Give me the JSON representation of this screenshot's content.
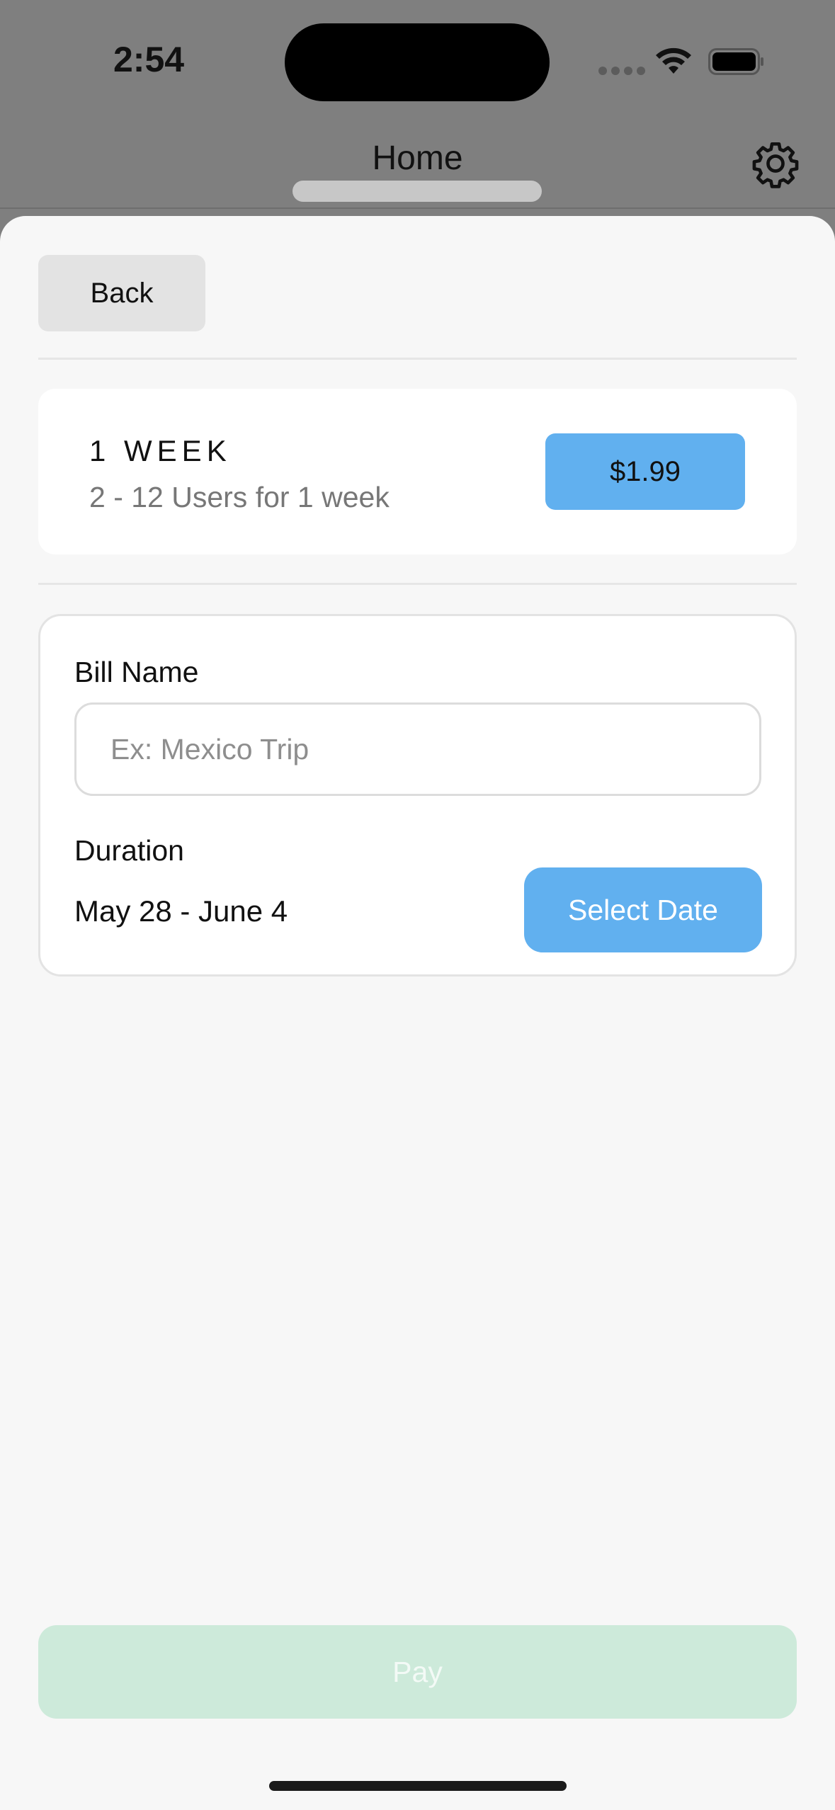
{
  "status_bar": {
    "time": "2:54",
    "icons": [
      "signal-dots-icon",
      "wifi-icon",
      "battery-icon"
    ]
  },
  "nav": {
    "title": "Home",
    "settings_icon": "gear-icon"
  },
  "sheet": {
    "back_label": "Back",
    "plan": {
      "title": "1 WEEK",
      "description": "2 - 12 Users for 1 week",
      "price": "$1.99"
    },
    "form": {
      "bill_name_label": "Bill Name",
      "bill_name_placeholder": "Ex: Mexico Trip",
      "bill_name_value": "",
      "duration_label": "Duration",
      "duration_value": "May 28 - June 4",
      "select_date_label": "Select Date"
    },
    "pay_label": "Pay"
  },
  "colors": {
    "accent_blue": "#61b0ef",
    "pay_disabled": "#cdeada",
    "sheet_background": "#f7f7f7",
    "dimmed_background": "#7f7f7f"
  }
}
